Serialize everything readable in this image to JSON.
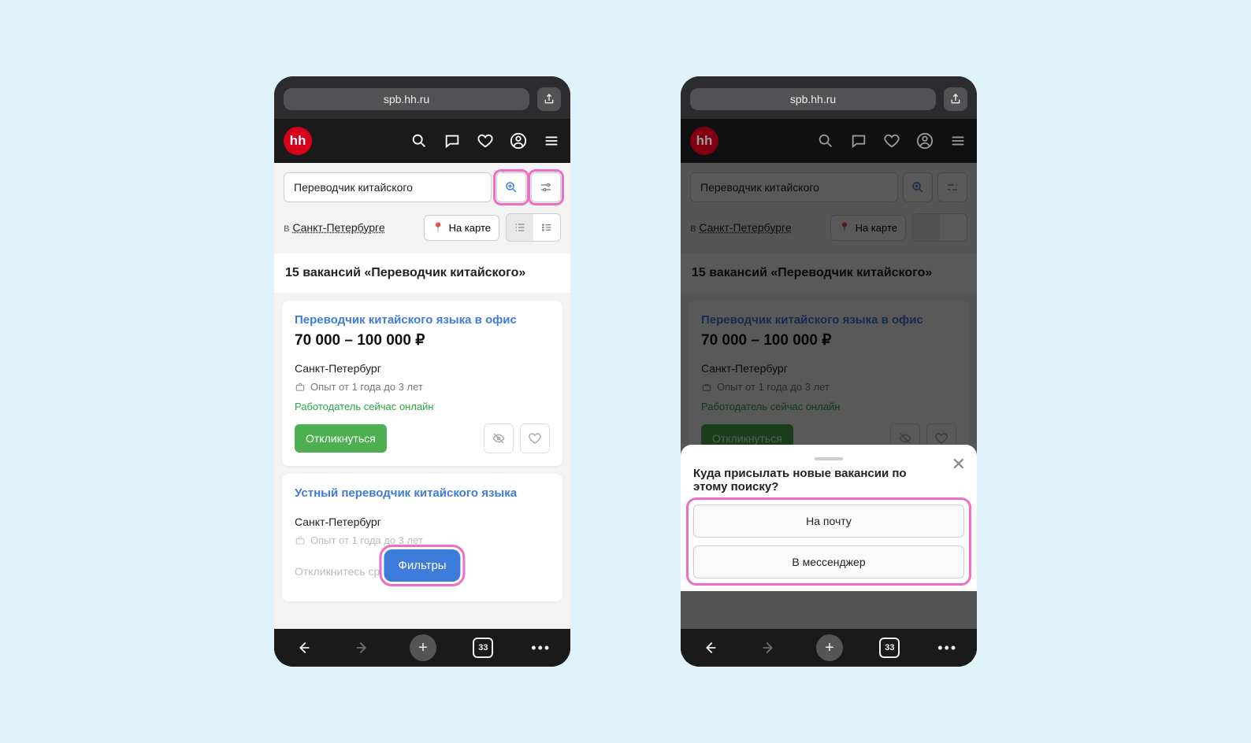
{
  "browser": {
    "url": "spb.hh.ru",
    "tab_count": "33"
  },
  "header": {
    "logo": "hh"
  },
  "search": {
    "query": "Переводчик китайского"
  },
  "location": {
    "prefix": "в ",
    "city": "Санкт-Петербурге",
    "map_label": "На карте"
  },
  "results_title": "15 вакансий «Переводчик китайского»",
  "job1": {
    "title": "Переводчик китайского языка в офис",
    "salary": "70 000 – 100 000 ₽",
    "city": "Санкт-Петербург",
    "experience": "Опыт от 1 года до 3 лет",
    "online": "Работодатель сейчас онлайн",
    "apply": "Откликнуться"
  },
  "job2": {
    "title": "Устный переводчик китайского языка",
    "city": "Санкт-Петербург",
    "experience": "Опыт от 1 года до 3 лет",
    "placeholder": "Откликнитесь ср..."
  },
  "filters_label": "Фильтры",
  "sheet": {
    "title": "Куда присылать новые вакансии по этому поиску?",
    "email": "На почту",
    "messenger": "В мессенджер"
  }
}
